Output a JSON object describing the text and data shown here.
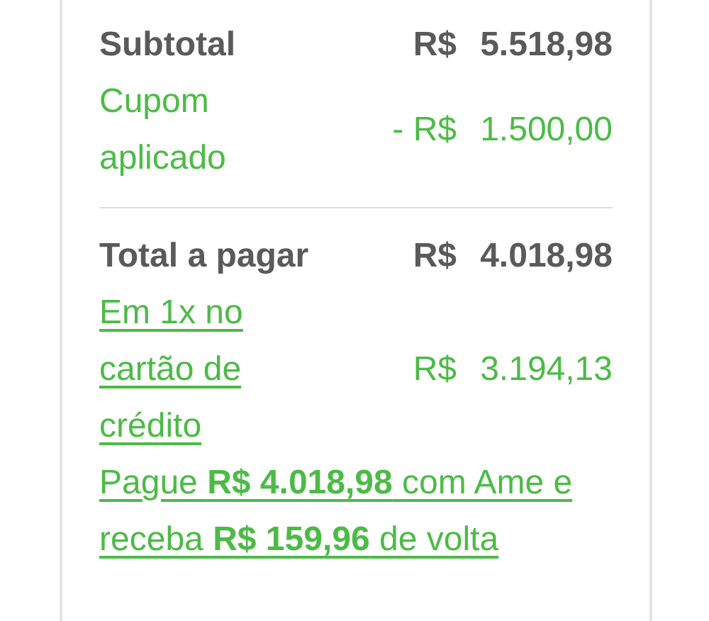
{
  "summary": [
    {
      "kind": "subtotal",
      "label": "Subtotal",
      "currency": "R$",
      "amount": "5.518,98"
    },
    {
      "kind": "discount",
      "label": "Cupom aplicado",
      "currency": "- R$",
      "amount": "1.500,00"
    }
  ],
  "total": {
    "label": "Total a pagar",
    "currency": "R$",
    "amount": "4.018,98"
  },
  "installment": {
    "label": "Em 1x no cartão de crédito",
    "currency": "R$",
    "amount": "3.194,13"
  },
  "cashback": {
    "text": "Pague **R$ 4.018,98** com Ame e receba **R$ 159,96** de volta"
  }
}
